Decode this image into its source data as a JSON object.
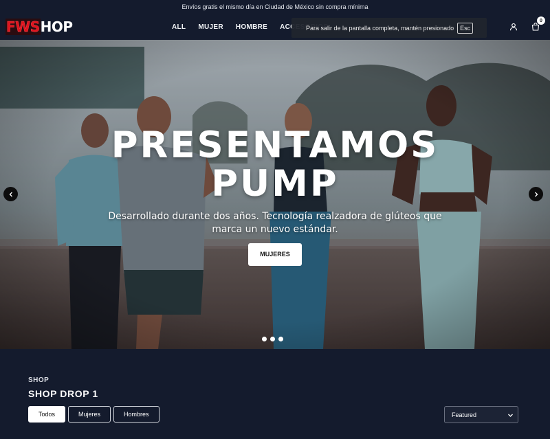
{
  "announcement": "Envíos gratis el mismo día en Ciudad de México sin compra mínima",
  "brand": {
    "part1": "FWS",
    "part2": "HOP"
  },
  "nav": [
    "ALL",
    "MUJER",
    "HOMBRE",
    "ACCESORIOS"
  ],
  "fullscreen_notice": {
    "text": "Para salir de la pantalla completa, mantén presionado",
    "key": "Esc"
  },
  "cart": {
    "count": "0"
  },
  "hero": {
    "title_line1": "PRESENTAMOS",
    "title_line2": "PUMP",
    "subtitle": "Desarrollado durante dos años. Tecnología realzadora de glúteos que marca un nuevo estándar.",
    "cta": "MUJERES",
    "slides": 3,
    "active_slide": 1
  },
  "shop": {
    "eyebrow": "SHOP",
    "title": "SHOP DROP 1",
    "filters": [
      "Todos",
      "Mujeres",
      "Hombres"
    ],
    "active_filter": "Todos",
    "sort_selected": "Featured"
  },
  "colors": {
    "background": "#141b2d",
    "brand_red": "#e0141e"
  },
  "icons": [
    "account-icon",
    "cart-icon",
    "arrow-left-icon",
    "arrow-right-icon",
    "chevron-down-icon"
  ]
}
